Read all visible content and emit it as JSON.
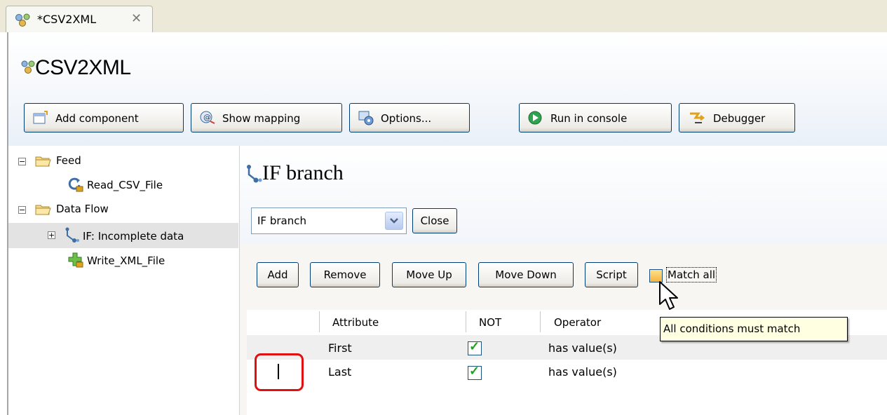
{
  "tab": {
    "label": "*CSV2XML"
  },
  "header": {
    "title": "CSV2XML"
  },
  "toolbar": {
    "add_component": "Add component",
    "show_mapping": "Show mapping",
    "options": "Options...",
    "run_in_console": "Run in console",
    "debugger": "Debugger"
  },
  "tree": {
    "feed": "Feed",
    "read_csv": "Read_CSV_File",
    "data_flow": "Data Flow",
    "if_item": "IF: Incomplete data",
    "write_xml": "Write_XML_File"
  },
  "panel": {
    "title": "IF branch",
    "select_value": "IF branch",
    "close": "Close",
    "buttons": {
      "add": "Add",
      "remove": "Remove",
      "move_up": "Move Up",
      "move_down": "Move Down",
      "script": "Script"
    },
    "match_all": "Match all",
    "tooltip": "All conditions must match"
  },
  "table": {
    "headers": {
      "attribute": "Attribute",
      "not": "NOT",
      "operator": "Operator"
    },
    "rows": [
      {
        "attribute": "First",
        "not": true,
        "operator": "has value(s)"
      },
      {
        "attribute": "Last",
        "not": true,
        "operator": "has value(s)"
      }
    ]
  },
  "colors": {
    "button_border": "#003c74",
    "highlight_box": "#e01010",
    "tooltip_bg": "#ffffe1",
    "check": "#21a121"
  }
}
